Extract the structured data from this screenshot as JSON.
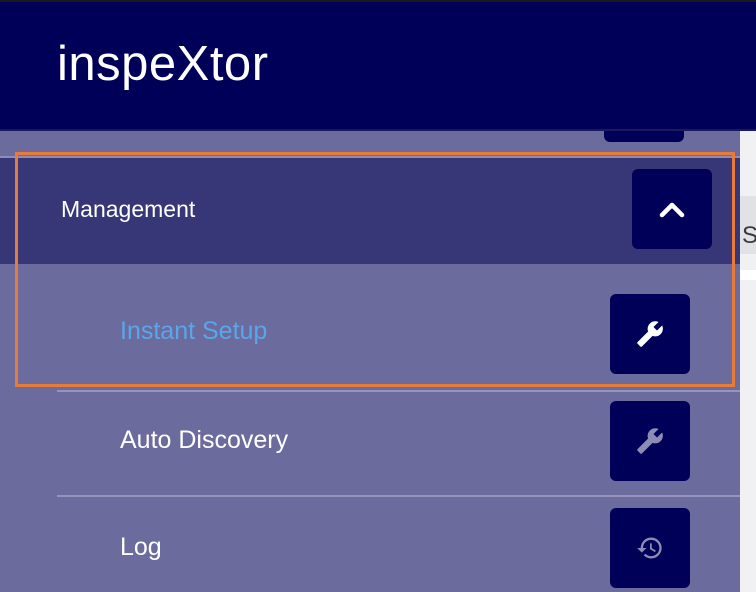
{
  "app": {
    "title": "inspeXtor"
  },
  "background": {
    "partial_text": "S"
  },
  "sidebar": {
    "section": {
      "label": "Management",
      "collapse_icon": "chevron-up-icon",
      "expanded": true
    },
    "items": [
      {
        "label": "Instant Setup",
        "icon": "wrench-icon",
        "active": true
      },
      {
        "label": "Auto Discovery",
        "icon": "wrench-icon",
        "active": false
      },
      {
        "label": "Log",
        "icon": "history-icon",
        "active": false
      }
    ]
  },
  "colors": {
    "header": "#000058",
    "section_bg": "#373676",
    "drawer_bg": "#6c6b9d",
    "active_text": "#5aa6e8",
    "highlight_border": "#e87a3a"
  }
}
